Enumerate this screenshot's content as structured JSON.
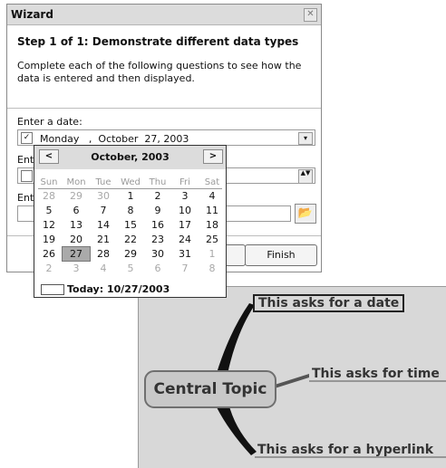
{
  "wizard": {
    "title": "Wizard",
    "close_symbol": "✕",
    "step_heading": "Step 1 of 1: Demonstrate different data types",
    "step_description": "Complete each of the following questions to see how the data is entered and then displayed.",
    "fields": {
      "date_label": "Enter a date:",
      "date_value": "Monday   ,  October  27, 2003",
      "date_checked": true,
      "time_label": "Ent",
      "link_label": "Ent"
    },
    "buttons": {
      "finish_label": "Finish"
    }
  },
  "calendar": {
    "month_title": "October, 2003",
    "prev_symbol": "<",
    "next_symbol": ">",
    "weekdays": [
      "Sun",
      "Mon",
      "Tue",
      "Wed",
      "Thu",
      "Fri",
      "Sat"
    ],
    "weeks": [
      [
        "28",
        "29",
        "30",
        "1",
        "2",
        "3",
        "4"
      ],
      [
        "5",
        "6",
        "7",
        "8",
        "9",
        "10",
        "11"
      ],
      [
        "12",
        "13",
        "14",
        "15",
        "16",
        "17",
        "18"
      ],
      [
        "19",
        "20",
        "21",
        "22",
        "23",
        "24",
        "25"
      ],
      [
        "26",
        "27",
        "28",
        "29",
        "30",
        "31",
        "1"
      ],
      [
        "2",
        "3",
        "4",
        "5",
        "6",
        "7",
        "8"
      ]
    ],
    "selected_day": "27",
    "today_text": "Today: 10/27/2003"
  },
  "mindmap": {
    "central_topic": "Central Topic",
    "subtopics": [
      "This asks for a date",
      "This asks for time",
      "This asks for a hyperlink"
    ]
  },
  "icons": {
    "check": "✓",
    "dropdown": "▾",
    "spin": "▲▼",
    "browse": "📂"
  }
}
